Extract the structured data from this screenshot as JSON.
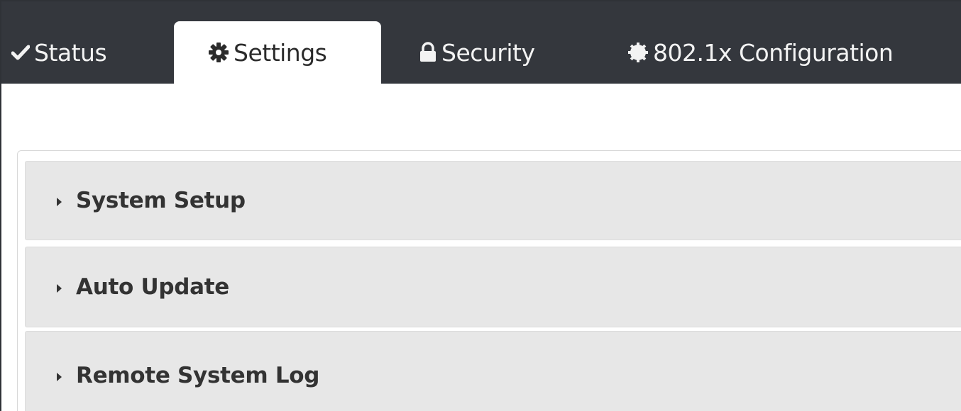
{
  "tabs": [
    {
      "label": "Status",
      "icon": "check-icon",
      "active": false
    },
    {
      "label": "Settings",
      "icon": "gear-icon",
      "active": true
    },
    {
      "label": "Security",
      "icon": "lock-icon",
      "active": false
    },
    {
      "label": "802.1x Configuration",
      "icon": "circle-gear-icon",
      "active": false
    }
  ],
  "panels": [
    {
      "title": "System Setup",
      "icon": "caret-right-icon",
      "expanded": false
    },
    {
      "title": "Auto Update",
      "icon": "caret-right-icon",
      "expanded": false
    },
    {
      "title": "Remote System Log",
      "icon": "caret-right-icon",
      "expanded": false
    }
  ],
  "colors": {
    "topbar": "#34373d",
    "tab_text": "#f3f3f3",
    "active_tab_bg": "#ffffff",
    "panel_bg": "#e7e7e7",
    "panel_text": "#333333"
  }
}
